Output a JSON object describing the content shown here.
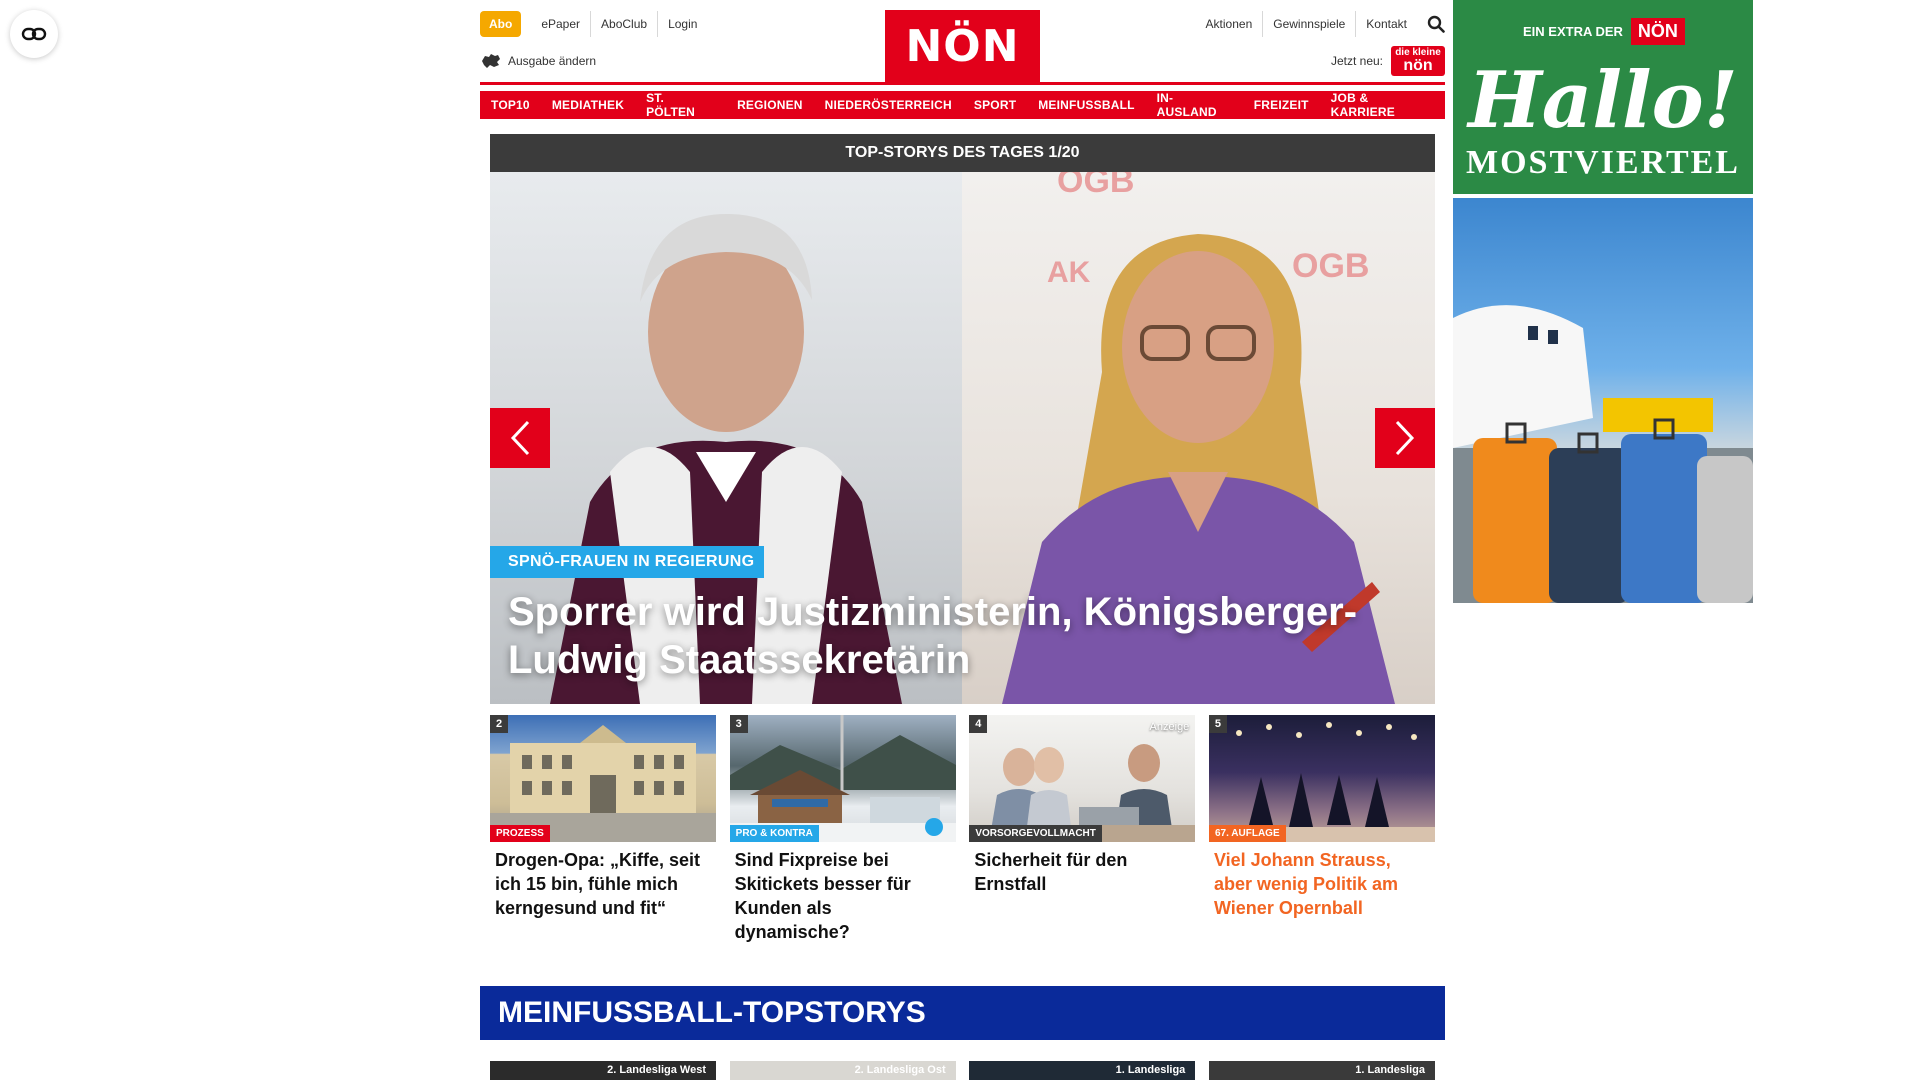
{
  "header": {
    "abo": "Abo",
    "links": [
      "ePaper",
      "AboClub",
      "Login"
    ],
    "ausgabe": "Ausgabe ändern",
    "logo": "NÖN",
    "right_links": [
      "Aktionen",
      "Gewinnspiele",
      "Kontakt"
    ],
    "jetzt_neu": "Jetzt neu:",
    "mini_logo_top": "die kleine",
    "mini_logo_bottom": "nön"
  },
  "nav": {
    "categories": [
      "TOP10",
      "MEDIATHEK",
      "ST. PÖLTEN",
      "REGIONEN",
      "NIEDERÖSTERREICH",
      "SPORT",
      "MEINFUSSBALL",
      "IN-AUSLAND",
      "FREIZEIT",
      "JOB & KARRIERE"
    ]
  },
  "hero": {
    "bar_title": "TOP-STORYS DES TAGES 1/20",
    "kicker": "SPNÖ-FRAUEN IN REGIERUNG",
    "headline": "Sporrer wird Justizministerin, Königsberger-Ludwig Staatssekretärin"
  },
  "stories": [
    {
      "num": "2",
      "tag": "PROZESS",
      "tag_color": "#e2001a",
      "title": "Drogen-Opa: „Kiffe, seit ich 15 bin, fühle mich kerngesund und fit“",
      "orange": false,
      "ad": ""
    },
    {
      "num": "3",
      "tag": "PRO & KONTRA",
      "tag_color": "#25a7e8",
      "title": "Sind Fixpreise bei Skitickets besser für Kunden als dynamische?",
      "orange": false,
      "ad": ""
    },
    {
      "num": "4",
      "tag": "VORSORGEVOLLMACHT",
      "tag_color": "#3b3b3b",
      "title": "Sicherheit für den Ernstfall",
      "orange": false,
      "ad": "Anzeige"
    },
    {
      "num": "5",
      "tag": "67. AUFLAGE",
      "tag_color": "#f26522",
      "title": "Viel Johann Strauss, aber wenig Politik am Wiener Opernball",
      "orange": true,
      "ad": ""
    }
  ],
  "section": {
    "title": "MEINFUSSBALL-TOPSTORYS",
    "cards": [
      "2. Landesliga West",
      "2. Landesliga Ost",
      "1. Landesliga",
      "1. Landesliga"
    ]
  },
  "ad": {
    "extra": "EIN EXTRA DER",
    "badge": "NÖN",
    "hallo": "Hallo!",
    "region": "MOSTVIERTEL"
  }
}
